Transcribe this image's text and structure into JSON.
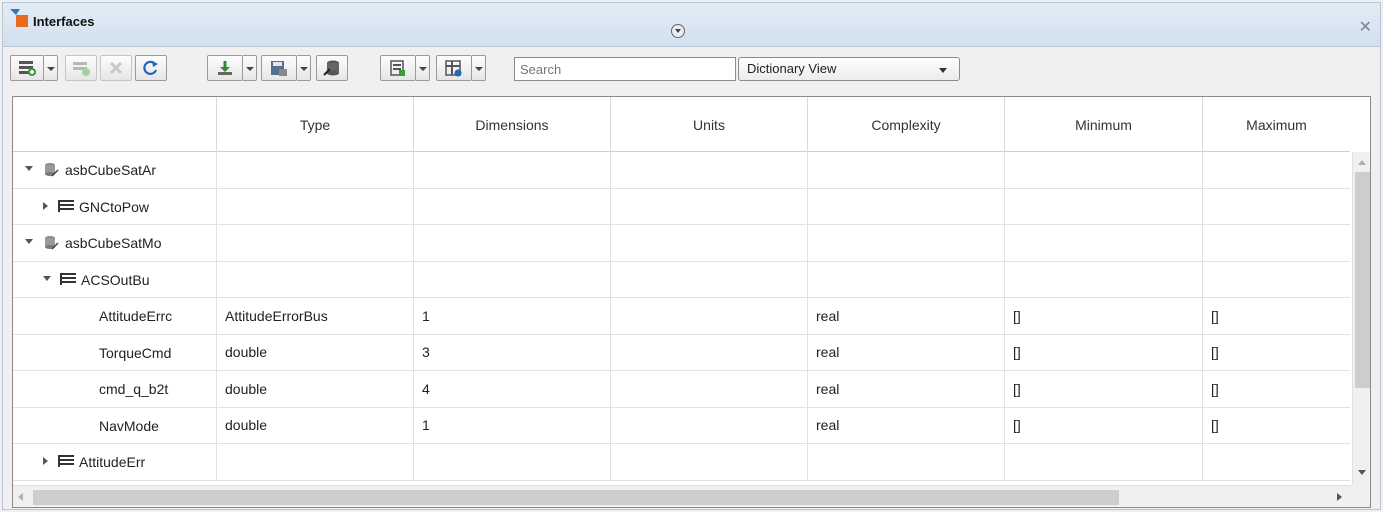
{
  "window": {
    "title": "Interfaces"
  },
  "toolbar": {
    "search_placeholder": "Search",
    "view_value": "Dictionary View"
  },
  "columns": [
    "",
    "Type",
    "Dimensions",
    "Units",
    "Complexity",
    "Minimum",
    "Maximum"
  ],
  "rows": [
    {
      "name": "asbCubeSatAr",
      "type": "",
      "dimensions": "",
      "units": "",
      "complexity": "",
      "minimum": "",
      "maximum": ""
    },
    {
      "name": "GNCtoPow",
      "type": "",
      "dimensions": "",
      "units": "",
      "complexity": "",
      "minimum": "",
      "maximum": ""
    },
    {
      "name": "asbCubeSatMo",
      "type": "",
      "dimensions": "",
      "units": "",
      "complexity": "",
      "minimum": "",
      "maximum": ""
    },
    {
      "name": "ACSOutBu",
      "type": "",
      "dimensions": "",
      "units": "",
      "complexity": "",
      "minimum": "",
      "maximum": ""
    },
    {
      "name": "AttitudeErrc",
      "type": "AttitudeErrorBus",
      "dimensions": "1",
      "units": "",
      "complexity": "real",
      "minimum": "[]",
      "maximum": "[]"
    },
    {
      "name": "TorqueCmd",
      "type": "double",
      "dimensions": "3",
      "units": "",
      "complexity": "real",
      "minimum": "[]",
      "maximum": "[]"
    },
    {
      "name": "cmd_q_b2t",
      "type": "double",
      "dimensions": "4",
      "units": "",
      "complexity": "real",
      "minimum": "[]",
      "maximum": "[]"
    },
    {
      "name": "NavMode",
      "type": "double",
      "dimensions": "1",
      "units": "",
      "complexity": "real",
      "minimum": "[]",
      "maximum": "[]"
    },
    {
      "name": "AttitudeErr",
      "type": "",
      "dimensions": "",
      "units": "",
      "complexity": "",
      "minimum": "",
      "maximum": ""
    }
  ]
}
